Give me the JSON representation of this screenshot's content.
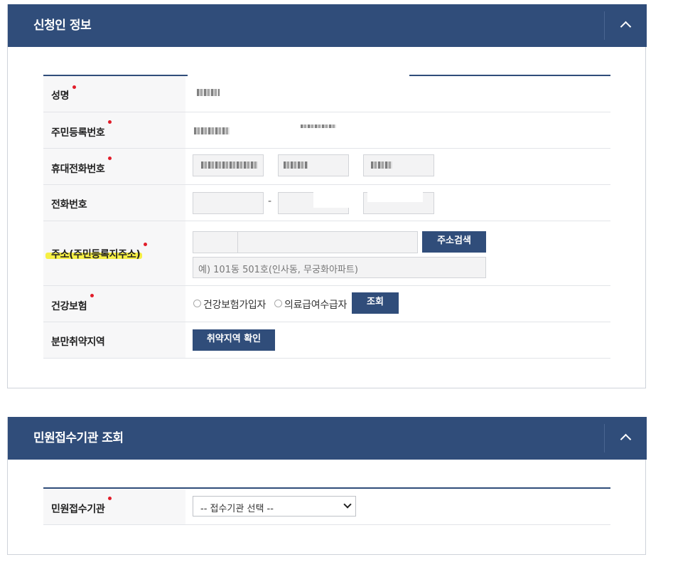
{
  "applicant": {
    "title": "신청인 정보",
    "rows": {
      "name": {
        "label": "성명",
        "value_masked": "██"
      },
      "rrn": {
        "label": "주민등록번호"
      },
      "mobile": {
        "label": "휴대전화번호"
      },
      "phone": {
        "label": "전화번호",
        "separator": "-"
      },
      "address": {
        "label": "주소(주민등록지주소)",
        "search_button": "주소검색",
        "detail_placeholder": "예) 101동 501호(인사동, 무궁화아파트)"
      },
      "insurance": {
        "label": "건강보험",
        "options": [
          "건강보험가입자",
          "의료급여수급자"
        ],
        "lookup_button": "조회"
      },
      "region": {
        "label": "분만취약지역",
        "check_button": "취약지역 확인"
      }
    }
  },
  "office": {
    "title": "민원접수기관 조회",
    "row": {
      "label": "민원접수기관",
      "select_value": "-- 접수기관 선택 --"
    }
  },
  "colors": {
    "header": "#304d7a",
    "required": "#e11d2a",
    "highlight": "#f6ee3a"
  },
  "icons": {
    "collapse": "chevron-up-icon",
    "dropdown": "chevron-down-icon"
  }
}
